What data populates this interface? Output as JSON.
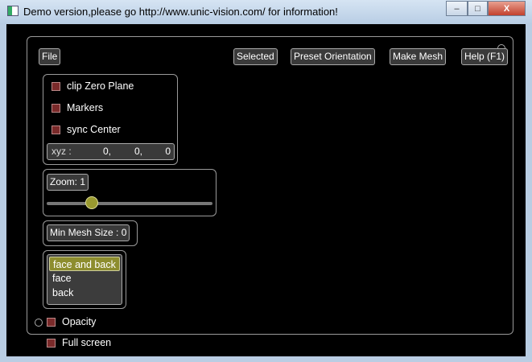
{
  "window": {
    "title": "Demo version,please go http://www.unic-vision.com/ for information!",
    "minimize": "–",
    "maximize": "□",
    "close": "X"
  },
  "toolbar": {
    "file": "File",
    "selected": "Selected",
    "preset": "Preset Orientation",
    "make_mesh": "Make Mesh",
    "help": "Help (F1)"
  },
  "options": {
    "clip": "clip Zero Plane",
    "markers": "Markers",
    "sync": "sync Center",
    "xyz_label": "xyz  :",
    "x": "0,",
    "y": "0,",
    "z": "0"
  },
  "zoom": {
    "label": "Zoom: 1",
    "value_fraction": 0.27
  },
  "mesh": {
    "label": "Min Mesh Size : 0"
  },
  "faces": {
    "items": [
      "face and back",
      "face",
      "back"
    ],
    "selected": "face and back"
  },
  "opacity": "Opacity",
  "fullscreen": "Full screen",
  "colors": {
    "accent": "#8d8d2e",
    "checkbox": "#7a2a2a"
  }
}
